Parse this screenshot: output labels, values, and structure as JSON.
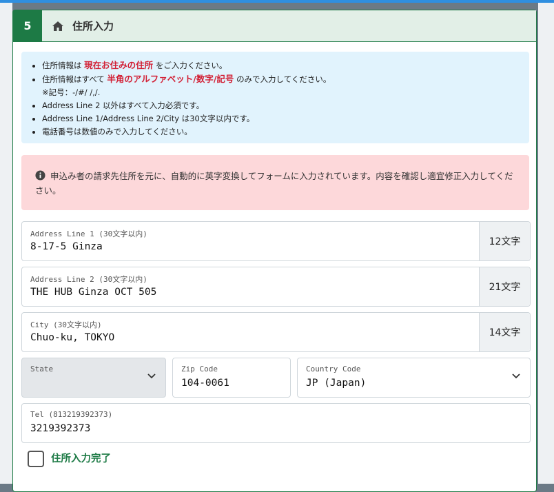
{
  "section": {
    "step_number": "5",
    "title": "住所入力",
    "icon": "home-icon"
  },
  "info": {
    "line1_pre": "住所情報は",
    "line1_highlight": "現在お住みの住所",
    "line1_post": "をご入力ください。",
    "line2_pre": "住所情報はすべて",
    "line2_highlight": "半角のアルファベット/数字/記号",
    "line2_post": "のみで入力してください。",
    "line2_note": "※記号：-/#/ /,/.",
    "line3": "Address Line 2 以外はすべて入力必須です。",
    "line4": "Address Line 1/Address Line 2/City は30文字以内です。",
    "line5": "電話番号は数値のみで入力してください。",
    "highlight_color": "#d22035"
  },
  "alert": {
    "icon": "info-circle-icon",
    "text": "申込み者の請求先住所を元に、自動的に英字変換してフォームに入力されています。内容を確認し適宜修正入力してください。"
  },
  "form": {
    "address1": {
      "label": "Address Line 1 (30文字以内)",
      "value": "8-17-5 Ginza",
      "count": "12文字"
    },
    "address2": {
      "label": "Address Line 2 (30文字以内)",
      "value": "THE HUB Ginza OCT 505",
      "count": "21文字"
    },
    "city": {
      "label": "City (30文字以内)",
      "value": "Chuo-ku, TOKYO",
      "count": "14文字"
    },
    "state": {
      "label": "State",
      "value": ""
    },
    "zip": {
      "label": "Zip Code",
      "value": "104-0061"
    },
    "country": {
      "label": "Country Code",
      "value": "JP (Japan)"
    },
    "tel": {
      "label": "Tel (813219392373)",
      "value": "3219392373"
    }
  },
  "completion": {
    "label": "住所入力完了",
    "checked": false
  },
  "colors": {
    "accent_green": "#1d7a45",
    "info_bg": "#e1f3fd",
    "alert_bg": "#fdd8da",
    "topbar_blue": "#2f8fe0"
  }
}
